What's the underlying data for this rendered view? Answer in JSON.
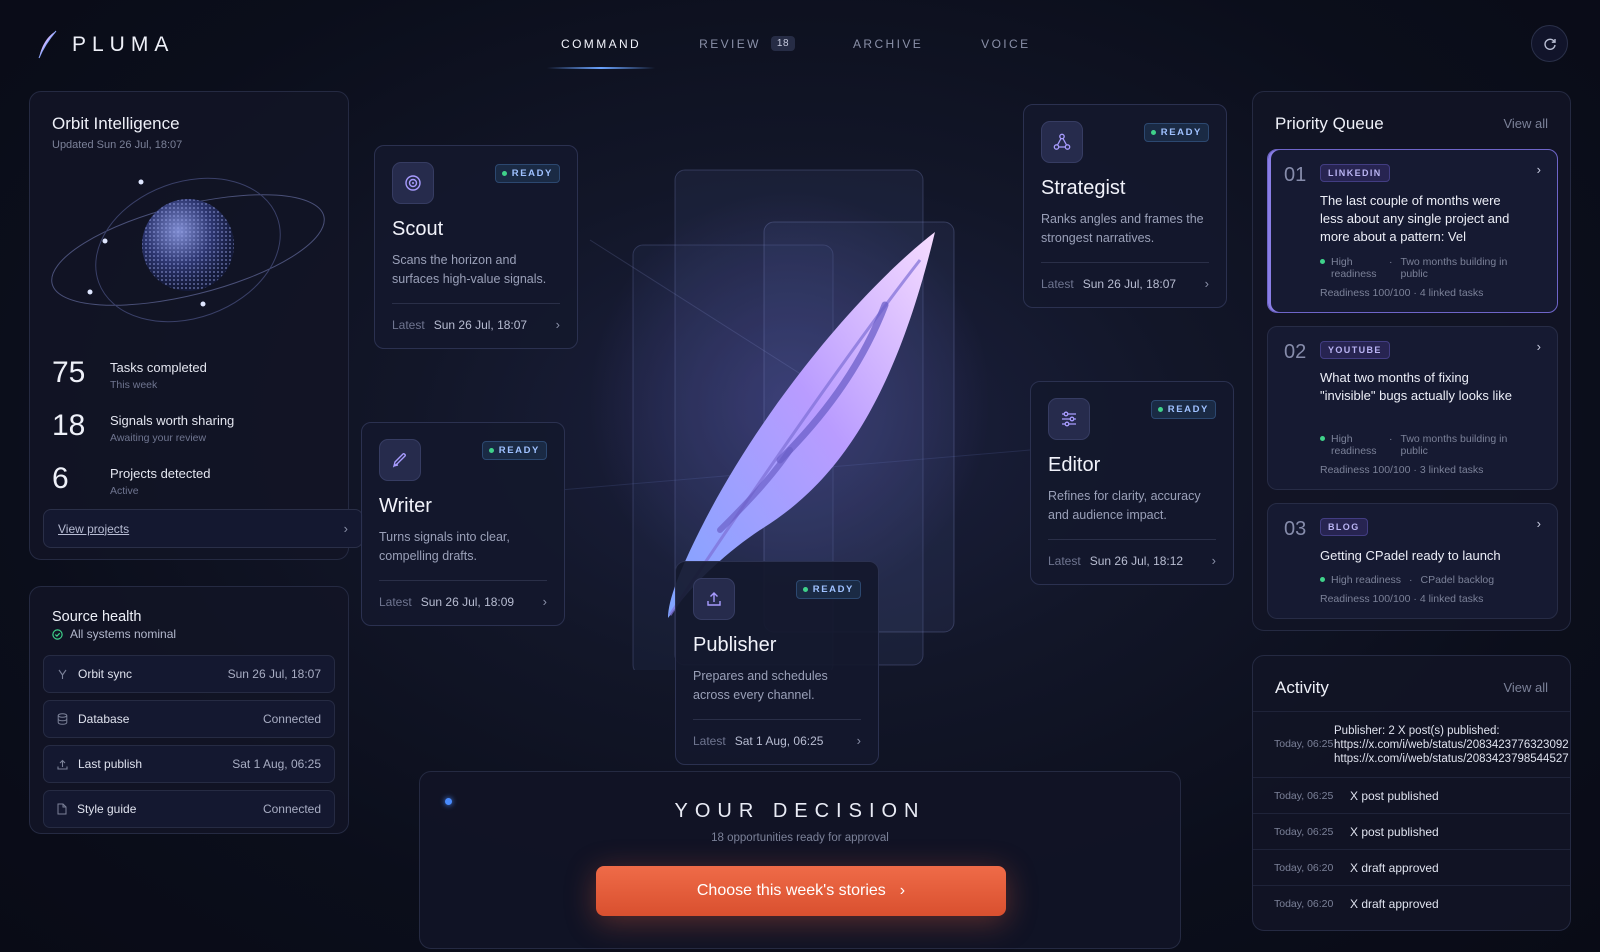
{
  "brand": {
    "name": "PLUMA"
  },
  "nav": {
    "tabs": [
      {
        "label": "COMMAND"
      },
      {
        "label": "REVIEW",
        "badge": "18"
      },
      {
        "label": "ARCHIVE"
      },
      {
        "label": "VOICE"
      }
    ]
  },
  "orbit": {
    "title": "Orbit Intelligence",
    "updated": "Updated Sun 26 Jul, 18:07",
    "stats": [
      {
        "value": "75",
        "label": "Tasks completed",
        "sub": "This week"
      },
      {
        "value": "18",
        "label": "Signals worth sharing",
        "sub": "Awaiting your review"
      },
      {
        "value": "6",
        "label": "Projects detected",
        "sub": "Active"
      }
    ],
    "link": "View projects"
  },
  "source_health": {
    "title": "Source health",
    "status": "All systems nominal",
    "rows": [
      {
        "name": "Orbit sync",
        "value": "Sun 26 Jul, 18:07",
        "icon": "branch-icon"
      },
      {
        "name": "Database",
        "value": "Connected",
        "icon": "database-icon"
      },
      {
        "name": "Last publish",
        "value": "Sat 1 Aug, 06:25",
        "icon": "upload-icon"
      },
      {
        "name": "Style guide",
        "value": "Connected",
        "icon": "document-icon"
      }
    ]
  },
  "agents": {
    "scout": {
      "name": "Scout",
      "status": "READY",
      "desc": "Scans the horizon and surfaces high-value signals.",
      "latest_label": "Latest",
      "latest": "Sun 26 Jul, 18:07",
      "icon": "target-icon"
    },
    "writer": {
      "name": "Writer",
      "status": "READY",
      "desc": "Turns signals into clear, compelling drafts.",
      "latest_label": "Latest",
      "latest": "Sun 26 Jul, 18:09",
      "icon": "pen-icon"
    },
    "strategist": {
      "name": "Strategist",
      "status": "READY",
      "desc": "Ranks angles and frames the strongest narratives.",
      "latest_label": "Latest",
      "latest": "Sun 26 Jul, 18:07",
      "icon": "network-icon"
    },
    "editor": {
      "name": "Editor",
      "status": "READY",
      "desc": "Refines for clarity, accuracy and audience impact.",
      "latest_label": "Latest",
      "latest": "Sun 26 Jul, 18:12",
      "icon": "sliders-icon"
    },
    "publisher": {
      "name": "Publisher",
      "status": "READY",
      "desc": "Prepares and schedules across every channel.",
      "latest_label": "Latest",
      "latest": "Sat 1 Aug, 06:25",
      "icon": "upload-icon"
    }
  },
  "decision": {
    "title": "YOUR DECISION",
    "subtitle": "18 opportunities ready for approval",
    "button": "Choose this week's stories"
  },
  "queue": {
    "title": "Priority Queue",
    "view_all": "View all",
    "items": [
      {
        "num": "01",
        "tag": "LINKEDIN",
        "title": "The last couple of months were less about any single project and more about a pattern: Vel",
        "readiness_word": "High readiness",
        "project": "Two months building in public",
        "readiness": "Readiness 100/100 · 4 linked tasks"
      },
      {
        "num": "02",
        "tag": "YOUTUBE",
        "title": "What two months of fixing \"invisible\" bugs actually looks like",
        "readiness_word": "High readiness",
        "project": "Two months building in public",
        "readiness": "Readiness 100/100 · 3 linked tasks"
      },
      {
        "num": "03",
        "tag": "BLOG",
        "title": "Getting CPadel ready to launch",
        "readiness_word": "High readiness",
        "project": "CPadel backlog",
        "readiness": "Readiness 100/100 · 4 linked tasks"
      }
    ]
  },
  "activity": {
    "title": "Activity",
    "view_all": "View all",
    "items": [
      {
        "time": "Today, 06:25",
        "text": "Publisher: 2 X post(s) published:",
        "line2": "https://x.com/i/web/status/2083423776323092",
        "line3": "https://x.com/i/web/status/2083423798544527"
      },
      {
        "time": "Today, 06:25",
        "text": "X post published"
      },
      {
        "time": "Today, 06:25",
        "text": "X post published"
      },
      {
        "time": "Today, 06:20",
        "text": "X draft approved"
      },
      {
        "time": "Today, 06:20",
        "text": "X draft approved"
      }
    ]
  },
  "colors": {
    "accent": "#6aa3ff",
    "cta": "#e85c3a",
    "ready": "#3fd28a",
    "feather": "#c9a4ff"
  }
}
